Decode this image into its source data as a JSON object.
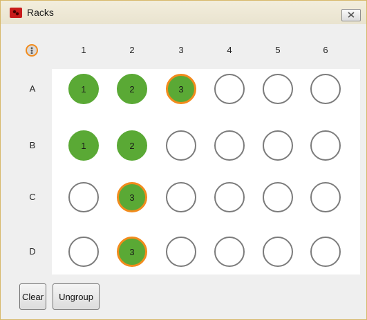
{
  "window": {
    "title": "Racks",
    "close_icon": "close-icon"
  },
  "columns": [
    "1",
    "2",
    "3",
    "4",
    "5",
    "6"
  ],
  "rows": [
    "A",
    "B",
    "C",
    "D"
  ],
  "wells": [
    [
      {
        "label": "1",
        "state": "filled"
      },
      {
        "label": "2",
        "state": "filled"
      },
      {
        "label": "3",
        "state": "grouped"
      },
      {
        "label": "",
        "state": "empty"
      },
      {
        "label": "",
        "state": "empty"
      },
      {
        "label": "",
        "state": "empty"
      }
    ],
    [
      {
        "label": "1",
        "state": "filled"
      },
      {
        "label": "2",
        "state": "filled"
      },
      {
        "label": "",
        "state": "empty"
      },
      {
        "label": "",
        "state": "empty"
      },
      {
        "label": "",
        "state": "empty"
      },
      {
        "label": "",
        "state": "empty"
      }
    ],
    [
      {
        "label": "",
        "state": "empty"
      },
      {
        "label": "3",
        "state": "grouped"
      },
      {
        "label": "",
        "state": "empty"
      },
      {
        "label": "",
        "state": "empty"
      },
      {
        "label": "",
        "state": "empty"
      },
      {
        "label": "",
        "state": "empty"
      }
    ],
    [
      {
        "label": "",
        "state": "empty"
      },
      {
        "label": "3",
        "state": "grouped"
      },
      {
        "label": "",
        "state": "empty"
      },
      {
        "label": "",
        "state": "empty"
      },
      {
        "label": "",
        "state": "empty"
      },
      {
        "label": "",
        "state": "empty"
      }
    ]
  ],
  "buttons": {
    "clear": "Clear",
    "ungroup": "Ungroup"
  },
  "colors": {
    "filled": "#5aa935",
    "group_ring": "#f28b1c",
    "empty_ring": "#7b7b7b"
  }
}
